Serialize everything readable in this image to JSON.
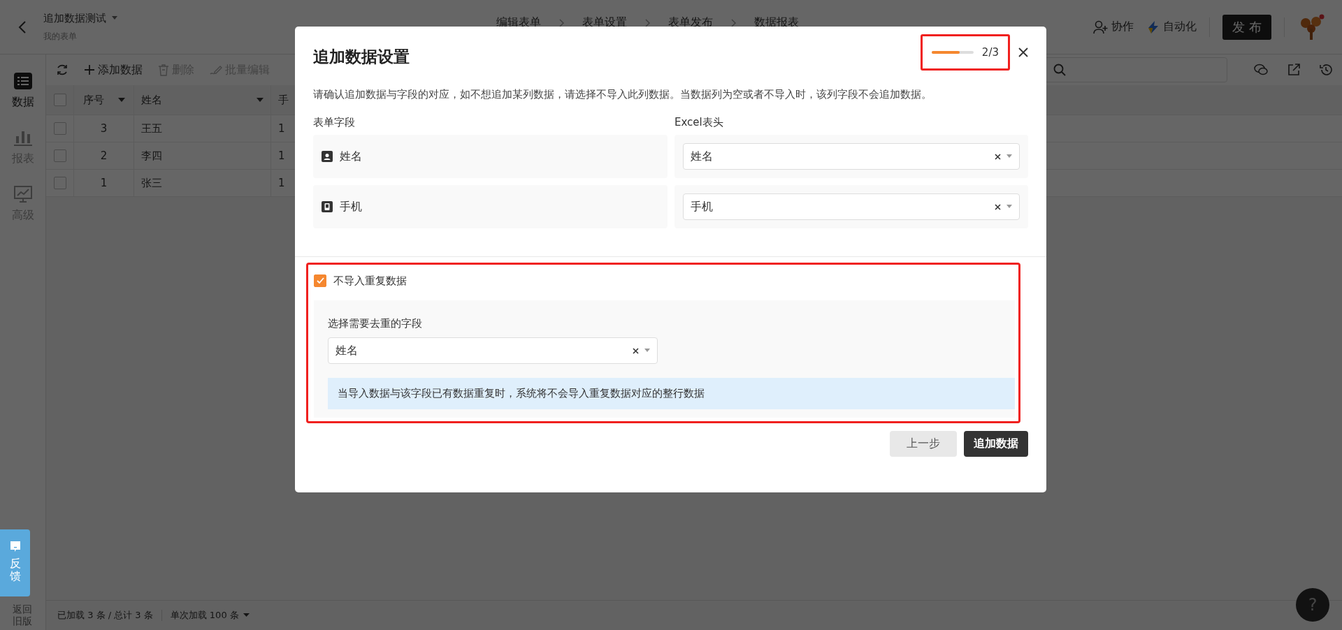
{
  "header": {
    "title": "追加数据测试",
    "subtitle": "我的表单",
    "steps": [
      "编辑表单",
      "表单设置",
      "表单发布",
      "数据报表"
    ],
    "actions": [
      {
        "label": "协作",
        "kind": "collab"
      },
      {
        "label": "自动化",
        "kind": "auto"
      }
    ],
    "publish": "发布"
  },
  "sidebar": {
    "items": [
      {
        "label": "数据",
        "selected": true,
        "kind": "data"
      },
      {
        "label": "报表",
        "selected": false,
        "kind": "chart"
      },
      {
        "label": "高级",
        "selected": false,
        "kind": "advanced"
      }
    ],
    "feedback": "反馈",
    "legacy": "返回旧版"
  },
  "toolbar": {
    "buttons": [
      {
        "label": "添加数据",
        "disabled": false,
        "kind": "add"
      },
      {
        "label": "删除",
        "disabled": true,
        "kind": "delete"
      },
      {
        "label": "批量编辑",
        "disabled": true,
        "kind": "edit"
      }
    ]
  },
  "table": {
    "select_all_checked": false,
    "columns": [
      "序号",
      "姓名",
      "手"
    ],
    "rows": [
      {
        "checked": false,
        "cells": [
          "3",
          "王五",
          "1"
        ]
      },
      {
        "checked": false,
        "cells": [
          "2",
          "李四",
          "1"
        ]
      },
      {
        "checked": false,
        "cells": [
          "1",
          "张三",
          "1"
        ]
      }
    ]
  },
  "footer": {
    "loaded": "已加载 3 条 / 总计 3 条",
    "page_size": "单次加载 100 条"
  },
  "help": "?",
  "dialog": {
    "title": "追加数据设置",
    "progress": {
      "level": 0.67,
      "label": "2/3"
    },
    "description": "请确认追加数据与字段的对应，如不想追加某列数据，请选择不导入此列数据。当数据列为空或者不导入时，该列字段不会追加数据。",
    "field_header": "表单字段",
    "excel_header": "Excel表头",
    "mappings": [
      {
        "field": "姓名",
        "kind": "person",
        "value": "姓名"
      },
      {
        "field": "手机",
        "kind": "phone",
        "value": "手机"
      }
    ],
    "dedupe": {
      "label": "不导入重复数据",
      "checked": true,
      "field_label": "选择需要去重的字段",
      "value": "姓名",
      "hint": "当导入数据与该字段已有数据重复时，系统将不会导入重复数据对应的整行数据"
    },
    "buttons": [
      {
        "label": "上一步",
        "kind": "secondary"
      },
      {
        "label": "追加数据",
        "kind": "primary"
      }
    ]
  }
}
